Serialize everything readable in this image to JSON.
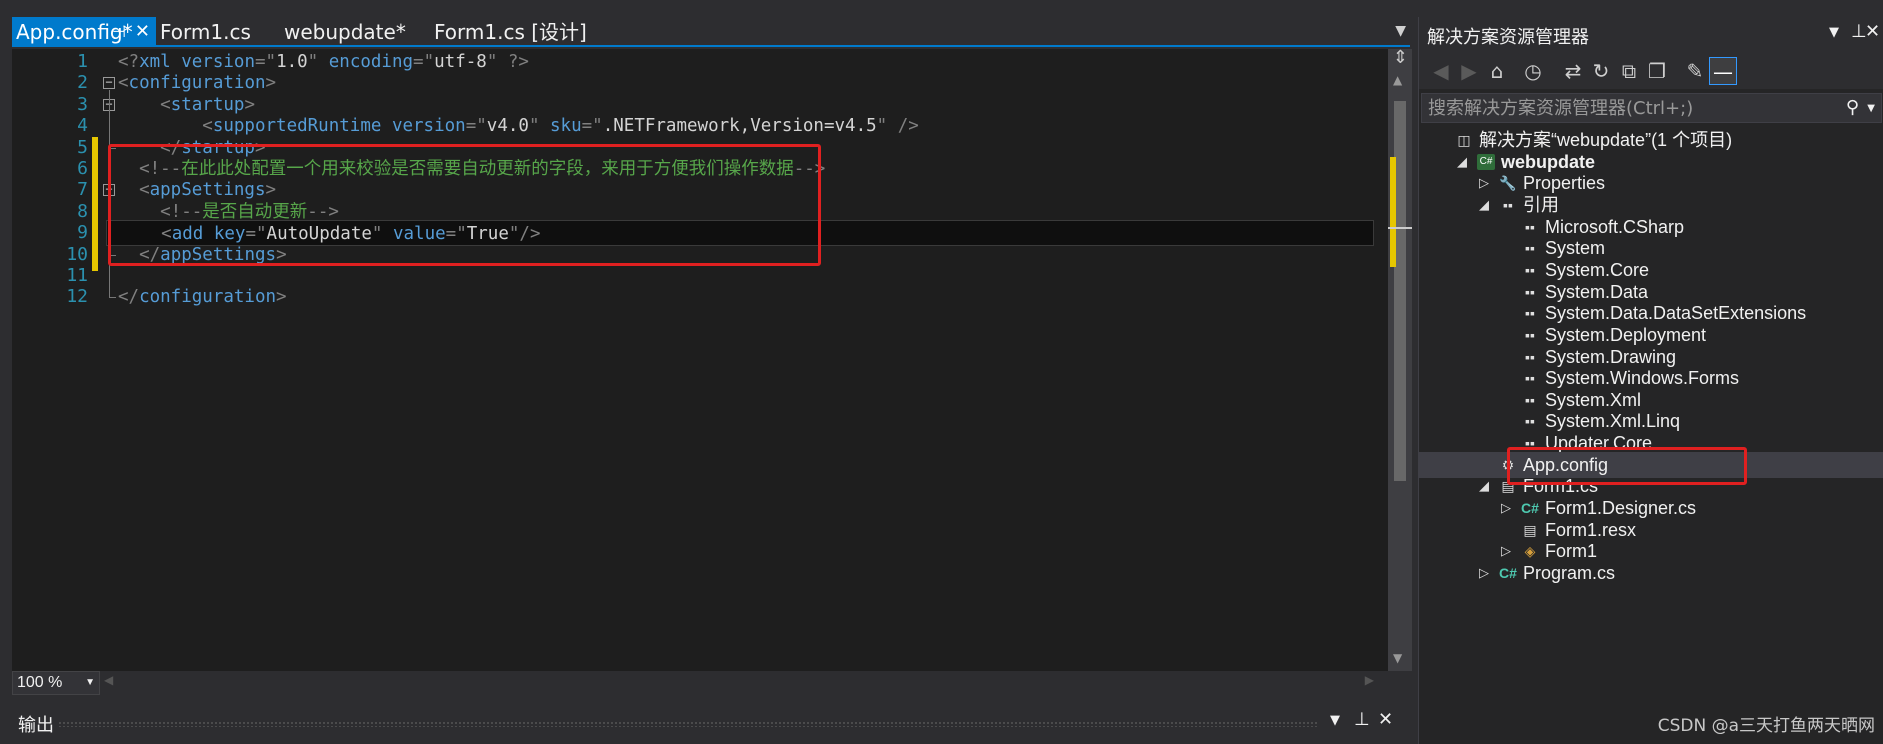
{
  "editor": {
    "tabs": [
      {
        "label": "App.config*",
        "active": true
      },
      {
        "label": "Form1.cs",
        "active": false
      },
      {
        "label": "webupdate*",
        "active": false
      },
      {
        "label": "Form1.cs [设计]",
        "active": false
      }
    ],
    "tab_pin_icon": "pin-icon",
    "tab_close_icon": "close-icon",
    "line_numbers": [
      "1",
      "2",
      "3",
      "4",
      "5",
      "6",
      "7",
      "8",
      "9",
      "10",
      "11",
      "12"
    ],
    "code_lines": [
      [
        {
          "k": "b",
          "t": "<?"
        },
        {
          "k": "t",
          "t": "xml"
        },
        {
          "k": "t",
          "t": " version"
        },
        {
          "k": "b",
          "t": "=\""
        },
        {
          "k": "v",
          "t": "1.0"
        },
        {
          "k": "b",
          "t": "\""
        },
        {
          "k": "t",
          "t": " encoding"
        },
        {
          "k": "b",
          "t": "=\""
        },
        {
          "k": "v",
          "t": "utf-8"
        },
        {
          "k": "b",
          "t": "\" ?>"
        }
      ],
      [
        {
          "k": "b",
          "t": "<"
        },
        {
          "k": "t",
          "t": "configuration"
        },
        {
          "k": "b",
          "t": ">"
        }
      ],
      [
        {
          "k": "b",
          "t": "    <"
        },
        {
          "k": "t",
          "t": "startup"
        },
        {
          "k": "b",
          "t": ">"
        }
      ],
      [
        {
          "k": "b",
          "t": "        <"
        },
        {
          "k": "t",
          "t": "supportedRuntime"
        },
        {
          "k": "t",
          "t": " version"
        },
        {
          "k": "b",
          "t": "=\""
        },
        {
          "k": "v",
          "t": "v4.0"
        },
        {
          "k": "b",
          "t": "\""
        },
        {
          "k": "t",
          "t": " sku"
        },
        {
          "k": "b",
          "t": "=\""
        },
        {
          "k": "v",
          "t": ".NETFramework,Version=v4.5"
        },
        {
          "k": "b",
          "t": "\" />"
        }
      ],
      [
        {
          "k": "b",
          "t": "    </"
        },
        {
          "k": "t",
          "t": "startup"
        },
        {
          "k": "b",
          "t": ">"
        }
      ],
      [
        {
          "k": "b",
          "t": "  <!--"
        },
        {
          "k": "c",
          "t": "在此此处配置一个用来校验是否需要自动更新的字段，来用于方便我们操作数据"
        },
        {
          "k": "b",
          "t": "-->"
        }
      ],
      [
        {
          "k": "b",
          "t": "  <"
        },
        {
          "k": "t",
          "t": "appSettings"
        },
        {
          "k": "b",
          "t": ">"
        }
      ],
      [
        {
          "k": "b",
          "t": "    <!--"
        },
        {
          "k": "c",
          "t": "是否自动更新"
        },
        {
          "k": "b",
          "t": "-->"
        }
      ],
      [
        {
          "k": "b",
          "t": "    <"
        },
        {
          "k": "t",
          "t": "add"
        },
        {
          "k": "t",
          "t": " key"
        },
        {
          "k": "b",
          "t": "=\""
        },
        {
          "k": "v",
          "t": "AutoUpdate"
        },
        {
          "k": "b",
          "t": "\""
        },
        {
          "k": "t",
          "t": " value"
        },
        {
          "k": "b",
          "t": "=\""
        },
        {
          "k": "v",
          "t": "True"
        },
        {
          "k": "b",
          "t": "\"/>"
        }
      ],
      [
        {
          "k": "b",
          "t": "  </"
        },
        {
          "k": "t",
          "t": "appSettings"
        },
        {
          "k": "b",
          "t": ">"
        }
      ],
      [],
      [
        {
          "k": "b",
          "t": "</"
        },
        {
          "k": "t",
          "t": "configuration"
        },
        {
          "k": "b",
          "t": ">"
        }
      ]
    ],
    "current_line": 9,
    "zoom": "100 %"
  },
  "output_panel": {
    "title": "输出"
  },
  "solution_explorer": {
    "title": "解决方案资源管理器",
    "search_placeholder": "搜索解决方案资源管理器(Ctrl+;)",
    "toolbar_icons": [
      "back-icon",
      "forward-icon",
      "home-icon",
      "history-icon",
      "sync-icon",
      "refresh-icon",
      "collapse-icon",
      "copy-icon",
      "properties-icon",
      "preview-icon"
    ],
    "tree": [
      {
        "label": "解决方案“webupdate”(1 个项目)",
        "indent": 0,
        "arrow": "",
        "icon": "solution-icon",
        "bold": false
      },
      {
        "label": "webupdate",
        "indent": 1,
        "arrow": "◢",
        "icon": "csharp-project-icon",
        "bold": true
      },
      {
        "label": "Properties",
        "indent": 2,
        "arrow": "▷",
        "icon": "wrench-icon",
        "bold": false
      },
      {
        "label": "引用",
        "indent": 2,
        "arrow": "◢",
        "icon": "references-icon",
        "bold": false
      },
      {
        "label": "Microsoft.CSharp",
        "indent": 3,
        "arrow": "",
        "icon": "reference-icon",
        "bold": false
      },
      {
        "label": "System",
        "indent": 3,
        "arrow": "",
        "icon": "reference-icon",
        "bold": false
      },
      {
        "label": "System.Core",
        "indent": 3,
        "arrow": "",
        "icon": "reference-icon",
        "bold": false
      },
      {
        "label": "System.Data",
        "indent": 3,
        "arrow": "",
        "icon": "reference-icon",
        "bold": false
      },
      {
        "label": "System.Data.DataSetExtensions",
        "indent": 3,
        "arrow": "",
        "icon": "reference-icon",
        "bold": false
      },
      {
        "label": "System.Deployment",
        "indent": 3,
        "arrow": "",
        "icon": "reference-icon",
        "bold": false
      },
      {
        "label": "System.Drawing",
        "indent": 3,
        "arrow": "",
        "icon": "reference-icon",
        "bold": false
      },
      {
        "label": "System.Windows.Forms",
        "indent": 3,
        "arrow": "",
        "icon": "reference-icon",
        "bold": false
      },
      {
        "label": "System.Xml",
        "indent": 3,
        "arrow": "",
        "icon": "reference-icon",
        "bold": false
      },
      {
        "label": "System.Xml.Linq",
        "indent": 3,
        "arrow": "",
        "icon": "reference-icon",
        "bold": false
      },
      {
        "label": "Updater.Core",
        "indent": 3,
        "arrow": "",
        "icon": "reference-icon",
        "bold": false
      },
      {
        "label": "App.config",
        "indent": 2,
        "arrow": "",
        "icon": "config-file-icon",
        "bold": false,
        "selected": true
      },
      {
        "label": "Form1.cs",
        "indent": 2,
        "arrow": "◢",
        "icon": "form-icon",
        "bold": false
      },
      {
        "label": "Form1.Designer.cs",
        "indent": 3,
        "arrow": "▷",
        "icon": "csharp-file-icon",
        "bold": false
      },
      {
        "label": "Form1.resx",
        "indent": 3,
        "arrow": "",
        "icon": "resx-file-icon",
        "bold": false
      },
      {
        "label": "Form1",
        "indent": 3,
        "arrow": "▷",
        "icon": "class-icon",
        "bold": false
      },
      {
        "label": "Program.cs",
        "indent": 2,
        "arrow": "▷",
        "icon": "csharp-file-icon",
        "bold": false
      }
    ]
  },
  "watermark": "CSDN @a三天打鱼两天晒网",
  "colors": {
    "accent": "#007acc",
    "annotation": "#e02020",
    "change_marker": "#e6c700"
  }
}
